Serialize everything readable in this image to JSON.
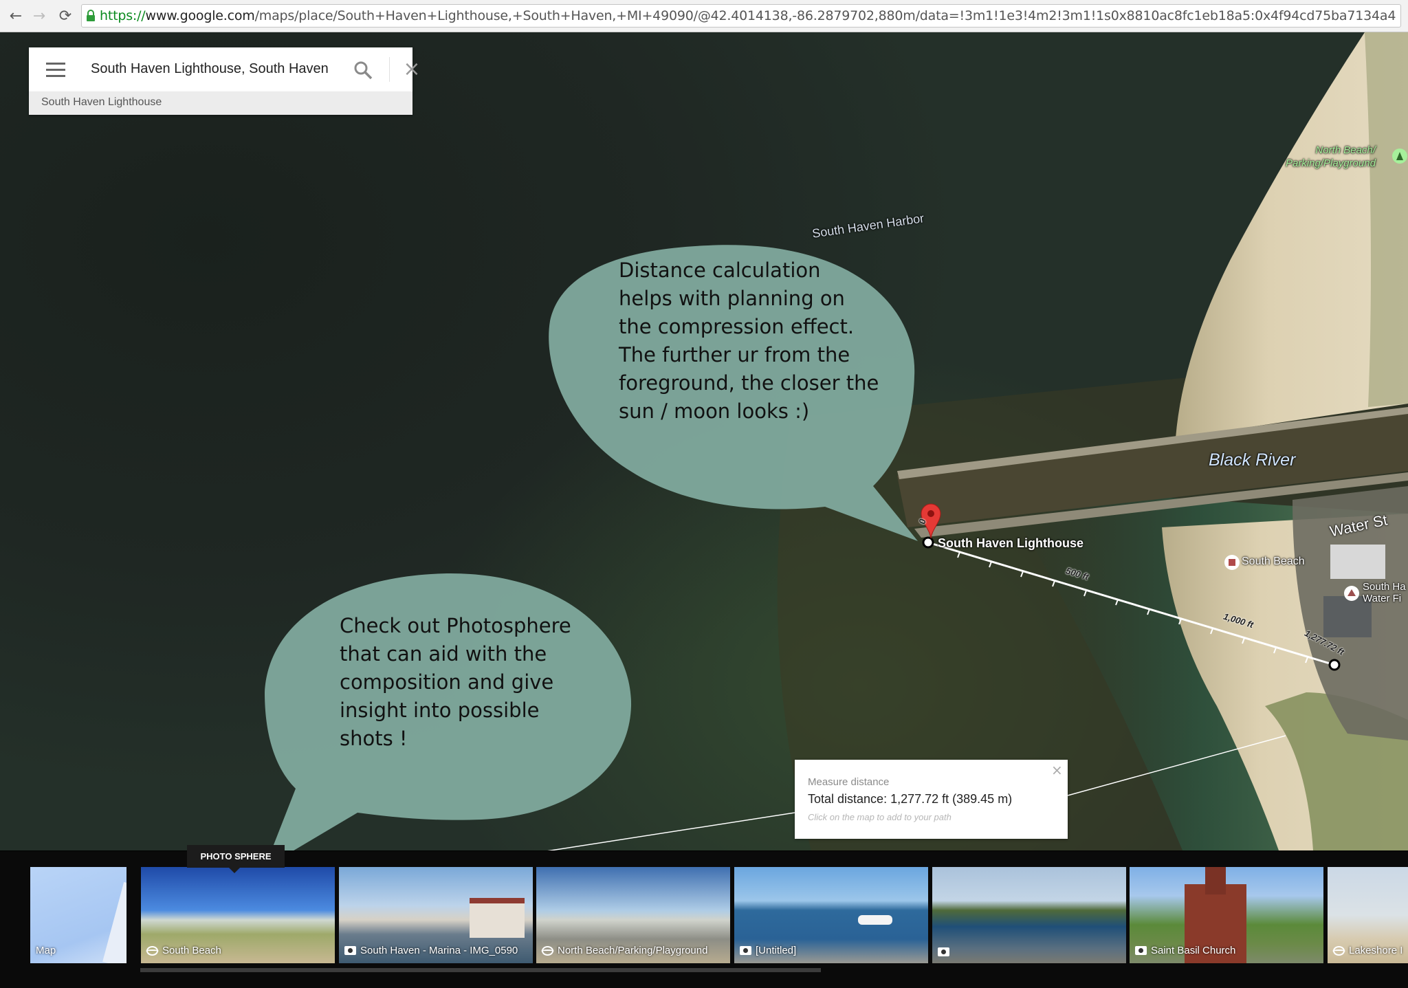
{
  "browser": {
    "back_glyph": "←",
    "forward_glyph": "→",
    "reload_glyph": "⟳",
    "url_scheme": "https://",
    "url_host": "www.google.com",
    "url_path": "/maps/place/South+Haven+Lighthouse,+South+Haven,+MI+49090/@42.4014138,-86.2879702,880m/data=!3m1!1e3!4m2!3m1!1s0x8810ac8fc1eb18a5:0x4f94cd75ba7134a4"
  },
  "search": {
    "value": "South Haven Lighthouse, South Haven",
    "suggestion": "South Haven Lighthouse",
    "clear_glyph": "×"
  },
  "map_labels": {
    "harbor": "South Haven Harbor",
    "north_beach_line1": "North Beach/",
    "north_beach_line2": "Parking/Playground",
    "black_river": "Black River",
    "water_st": "Water St",
    "lighthouse": "South Haven Lighthouse",
    "south_beach": "South Beach",
    "south_haven_water_line1": "South Ha",
    "south_haven_water_line2": "Water Fi"
  },
  "measure_path": {
    "start_label": "0",
    "tick_500": "500 ft",
    "tick_1000": "1,000 ft",
    "end_label": "1,277.72 ft"
  },
  "bubbles": {
    "lines_1": [
      "Distance calculation",
      "helps with planning on",
      "the compression effect.",
      "The further ur from the",
      "foreground, the closer the",
      "sun / moon looks :)"
    ],
    "lines_2": [
      "Check out Photosphere",
      "that can aid with the",
      "composition and give",
      "insight into possible",
      "shots !"
    ]
  },
  "measure_box": {
    "title": "Measure distance",
    "total": "Total distance: 1,277.72 ft (389.45 m)",
    "hint": "Click on the map to add to your path",
    "close_glyph": "×"
  },
  "filmstrip": {
    "tooltip": "PHOTO SPHERE",
    "thumbs": [
      {
        "label": "Map",
        "icon": "none"
      },
      {
        "label": "South Beach",
        "icon": "photo-sphere-icon"
      },
      {
        "label": "South Haven - Marina - IMG_0590",
        "icon": "camera-icon"
      },
      {
        "label": "North Beach/Parking/Playground",
        "icon": "photo-sphere-icon"
      },
      {
        "label": "[Untitled]",
        "icon": "camera-icon"
      },
      {
        "label": "",
        "icon": "camera-icon"
      },
      {
        "label": "Saint Basil Church",
        "icon": "camera-icon"
      },
      {
        "label": "Lakeshore I",
        "icon": "photo-sphere-icon"
      }
    ]
  },
  "colors": {
    "lake": "#1f2723",
    "beach": "#d9c8a3",
    "bubble": "#7fa89c",
    "pin": "#e53935",
    "url_green": "#0a8a1e"
  }
}
